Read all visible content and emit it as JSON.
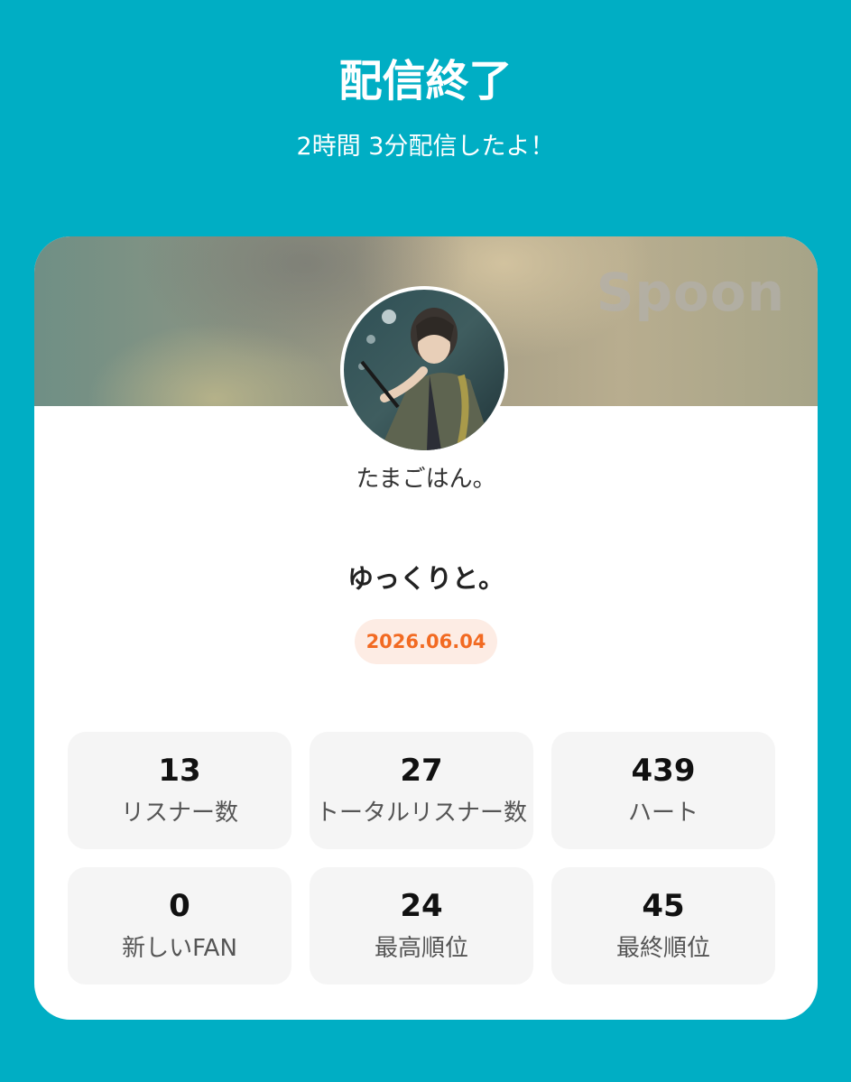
{
  "header": {
    "title": "配信終了",
    "subtitle": "2時間 3分配信したよ！"
  },
  "card": {
    "brand": "Spoon",
    "nickname": "たまごはん。",
    "live_title": "ゆっくりと。",
    "date": "2026.06.04"
  },
  "stats": [
    {
      "value": "13",
      "label": "リスナー数"
    },
    {
      "value": "27",
      "label": "トータルリスナー数"
    },
    {
      "value": "439",
      "label": "ハート"
    },
    {
      "value": "0",
      "label": "新しいFAN"
    },
    {
      "value": "24",
      "label": "最高順位"
    },
    {
      "value": "45",
      "label": "最終順位"
    }
  ],
  "colors": {
    "background": "#00aec4",
    "date_badge_bg": "#fdece4",
    "date_badge_text": "#f26a22"
  }
}
